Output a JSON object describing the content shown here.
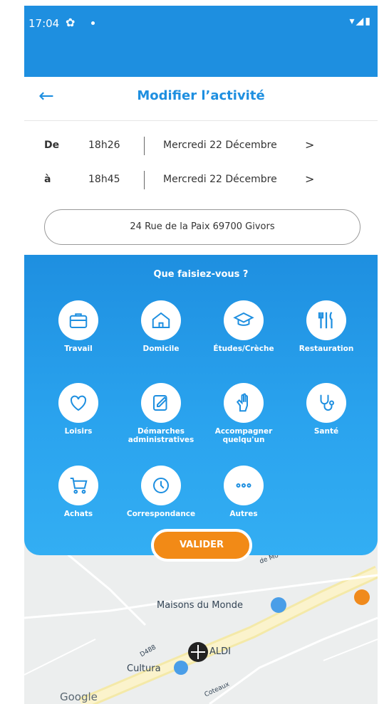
{
  "status_bar": {
    "time": "17:04",
    "right_icons": "▾◢▮"
  },
  "header": {
    "title": "Modifier l’activité"
  },
  "time_range": {
    "from": {
      "label": "De",
      "hour": "18h26",
      "date": "Mercredi 22 Décembre",
      "chevron": ">"
    },
    "to": {
      "label": "à",
      "hour": "18h45",
      "date": "Mercredi 22 Décembre",
      "chevron": ">"
    }
  },
  "address": "24 Rue de la Paix 69700 Givors",
  "activity": {
    "question": "Que faisiez-vous ?",
    "options": [
      {
        "label": "Travail",
        "icon": "briefcase-icon"
      },
      {
        "label": "Domicile",
        "icon": "home-icon"
      },
      {
        "label": "Études/Crèche",
        "icon": "graduation-cap-icon"
      },
      {
        "label": "Restauration",
        "icon": "utensils-icon"
      },
      {
        "label": "Loisirs",
        "icon": "heart-icon"
      },
      {
        "label": "Démarches administratives",
        "icon": "edit-document-icon"
      },
      {
        "label": "Accompagner quelqu'un",
        "icon": "helping-hand-icon"
      },
      {
        "label": "Santé",
        "icon": "stethoscope-icon"
      },
      {
        "label": "Achats",
        "icon": "cart-icon"
      },
      {
        "label": "Correspondance",
        "icon": "clock-icon"
      },
      {
        "label": "Autres",
        "icon": "more-dots-icon"
      }
    ],
    "validate_label": "VALIDER"
  },
  "map": {
    "places": {
      "maisons": "Maisons du Monde",
      "aldi": "ALDI",
      "cultura": "Cultura",
      "road_d488": "D488",
      "road_top": "de Mo",
      "road_bottom": "Coteaux",
      "attribution": "Google"
    }
  },
  "colors": {
    "primary": "#1e8fe0",
    "accent": "#f28a16",
    "panel_bottom": "#33aef3"
  }
}
